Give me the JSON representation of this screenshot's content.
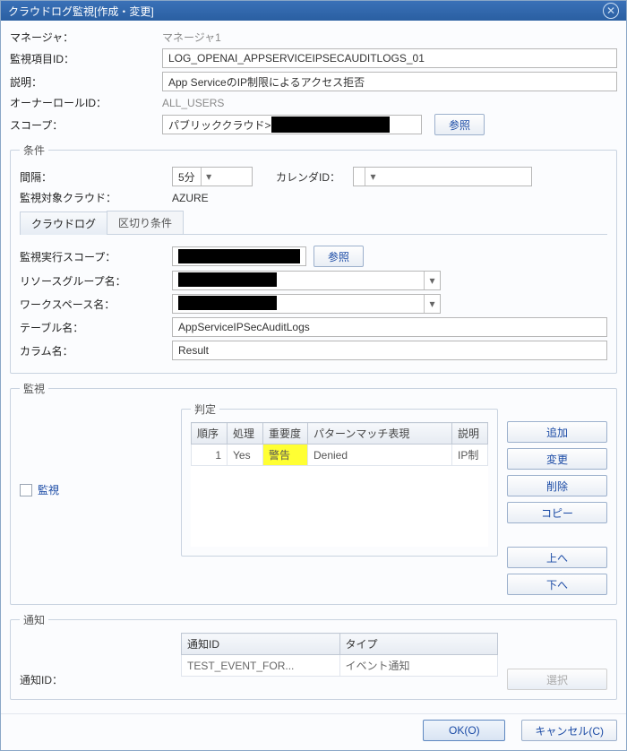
{
  "titlebar": {
    "text": "クラウドログ監視[作成・変更]"
  },
  "top": {
    "manager_label": "マネージャ：",
    "manager_value": "マネージャ1",
    "monitor_id_label": "監視項目ID：",
    "monitor_id_value": "LOG_OPENAI_APPSERVICEIPSECAUDITLOGS_01",
    "desc_label": "説明：",
    "desc_value": "App ServiceのIP制限によるアクセス拒否",
    "owner_label": "オーナーロールID：",
    "owner_value": "ALL_USERS",
    "scope_label": "スコープ：",
    "scope_prefix": "パブリッククラウド>",
    "scope_redacted": "████████",
    "refer_btn": "参照"
  },
  "condition": {
    "legend": "条件",
    "interval_label": "間隔：",
    "interval_value": "5分",
    "calendar_label": "カレンダID：",
    "calendar_value": "",
    "target_cloud_label": "監視対象クラウド：",
    "target_cloud_value": "AZURE",
    "tabs": {
      "cloudlog": "クラウドログ",
      "delimiter": "区切り条件"
    },
    "exec_scope_label": "監視実行スコープ：",
    "exec_scope_value": "██████████",
    "refer_btn": "参照",
    "resource_group_label": "リソースグループ名：",
    "resource_group_value": "██████████",
    "workspace_label": "ワークスペース名：",
    "workspace_value": "██████████",
    "table_label": "テーブル名：",
    "table_value": "AppServiceIPSecAuditLogs",
    "column_label": "カラム名：",
    "column_value": "Result"
  },
  "monitor": {
    "legend": "監視",
    "checkbox_label": "監視",
    "judgment_legend": "判定",
    "cols": {
      "order": "順序",
      "process": "処理",
      "severity": "重要度",
      "pattern": "パターンマッチ表現",
      "desc": "説明"
    },
    "rows": [
      {
        "order": "1",
        "process": "Yes",
        "severity": "警告",
        "pattern": "Denied",
        "desc": "IP制"
      }
    ],
    "buttons": {
      "add": "追加",
      "edit": "変更",
      "delete": "削除",
      "copy": "コピー",
      "up": "上へ",
      "down": "下へ"
    }
  },
  "notice": {
    "legend": "通知",
    "cols": {
      "id": "通知ID",
      "type": "タイプ"
    },
    "rows": [
      {
        "id": "TEST_EVENT_FOR...",
        "type": "イベント通知"
      }
    ],
    "notice_id_label": "通知ID：",
    "select_btn": "選択"
  },
  "footer": {
    "ok": "OK(O)",
    "cancel": "キャンセル(C)"
  }
}
